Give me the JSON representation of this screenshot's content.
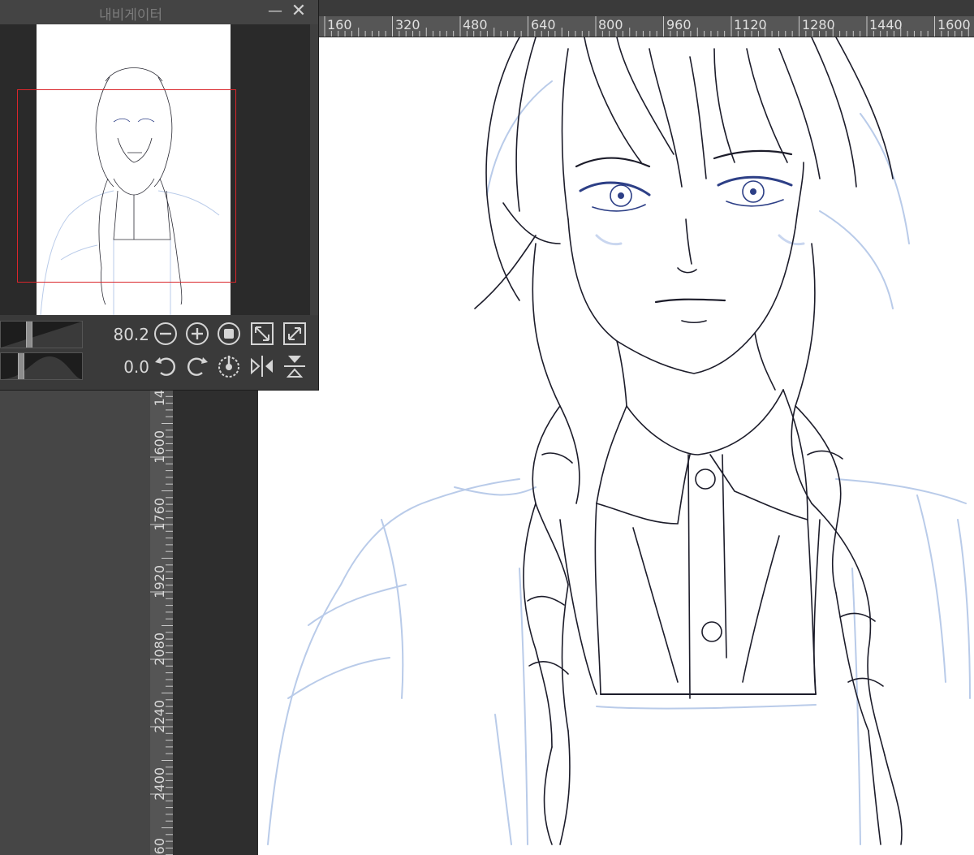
{
  "navigator": {
    "title": "내비게이터",
    "minimize_glyph": "—",
    "close_glyph": "✕",
    "zoom_value": "80.2",
    "rotation_value": "0.0"
  },
  "rulers": {
    "horizontal": [
      "160",
      "320",
      "480",
      "640",
      "800",
      "960",
      "1120",
      "1280",
      "1440",
      "1600"
    ],
    "vertical": [
      "14",
      "1600",
      "1760",
      "1920",
      "2080",
      "2240",
      "2400",
      "60"
    ]
  },
  "icons": {
    "zoom_out": "zoom-out-icon",
    "zoom_in": "zoom-in-icon",
    "reset_zoom": "stop-icon",
    "fit_to_window": "fit-icon",
    "actual_size": "full-size-icon",
    "rotate_left": "rotate-left-icon",
    "rotate_right": "rotate-right-icon",
    "reset_rotation": "reset-rotation-icon",
    "flip_horizontal": "flip-horizontal-icon",
    "flip_vertical": "flip-vertical-icon"
  },
  "colors": {
    "navigator_frame": "#d9262b",
    "line_art": "#1c1c2a",
    "sketch": "#b9cbe9",
    "accent_blue": "#2d3f86"
  }
}
